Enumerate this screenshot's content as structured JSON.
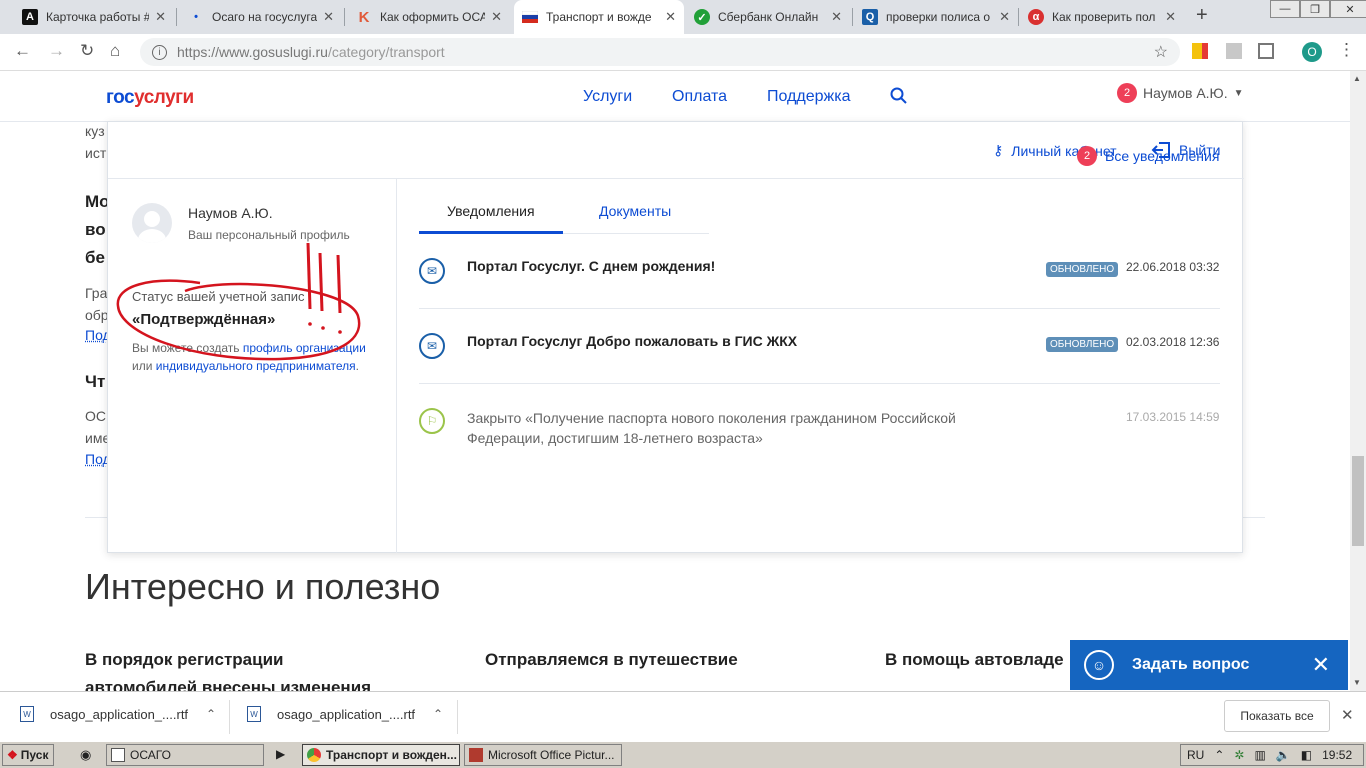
{
  "browser": {
    "tabs": [
      {
        "title": "Карточка работы #",
        "icon": "A",
        "icon_bg": "#111",
        "icon_color": "#fff"
      },
      {
        "title": "Осаго на госуслуга",
        "icon": "•",
        "icon_bg": "transparent",
        "icon_color": "#0d4cd3"
      },
      {
        "title": "Как оформить ОСА",
        "icon": "K",
        "icon_bg": "transparent",
        "icon_color": "#e05a3a"
      },
      {
        "title": "Транспорт и вожде",
        "icon": "",
        "icon_bg": "transparent",
        "icon_color": "#000"
      },
      {
        "title": "Сбербанк Онлайн",
        "icon": "✓",
        "icon_bg": "#21a038",
        "icon_color": "#fff"
      },
      {
        "title": "проверки полиса о",
        "icon": "Q",
        "icon_bg": "#1a5fa8",
        "icon_color": "#fff"
      },
      {
        "title": "Как проверить пол",
        "icon": "α",
        "icon_bg": "#d93030",
        "icon_color": "#fff"
      }
    ],
    "url": "https://www.gosuslugi.ru/category/transport",
    "url_host": "https://www.gosuslugi.ru",
    "url_path": "/category/transport",
    "profile_letter": "O"
  },
  "header": {
    "logo_part1": "гос",
    "logo_part2": "услуги",
    "nav": [
      "Услуги",
      "Оплата",
      "Поддержка"
    ],
    "notif_count": "2",
    "user_name": "Наумов А.Ю."
  },
  "background": {
    "frag1": "куз",
    "frag2": "ист",
    "bold1": "Мо",
    "bold2": "во",
    "bold3": "бе",
    "frag3": "Гра",
    "frag4": "обр",
    "link1": "Под",
    "bold4": "Чт",
    "frag5": "ОС",
    "frag6": "име",
    "link2": "Под",
    "section_title": "Интересно и полезно",
    "col1": [
      "В порядок регистрации",
      "автомобилей внесены изменения"
    ],
    "col2": "Отправляемся в путешествие",
    "col3": "В помощь автовладе"
  },
  "panel": {
    "cabinet_label": "Личный кабинет",
    "logout_label": "Выйти",
    "profile_name": "Наумов А.Ю.",
    "profile_sub": "Ваш персональный профиль",
    "status_label": "Статус вашей учетной запис",
    "status_value": "«Подтверждённая»",
    "note_pre": "Вы можете создать ",
    "note_link1": "профиль организации",
    "note_mid": " или ",
    "note_link2": "индивидуального предпринимателя",
    "note_post": ".",
    "tab_notifications": "Уведомления",
    "tab_documents": "Документы",
    "all_notif_count": "2",
    "all_notif_label": "Все уведомления",
    "notifications": [
      {
        "title": "Портал Госуслуг. С днем рождения!",
        "badge": "ОБНОВЛЕНО",
        "date": "22.06.2018 03:32"
      },
      {
        "title": "Портал Госуслуг Добро пожаловать в ГИС ЖКХ",
        "badge": "ОБНОВЛЕНО",
        "date": "02.03.2018 12:36"
      },
      {
        "text": "Закрыто «Получение паспорта нового поколения гражданином Российской Федерации, достигшим 18-летнего возраста»",
        "date": "17.03.2015 14:59"
      }
    ]
  },
  "chat": {
    "label": "Задать вопрос"
  },
  "downloads": {
    "files": [
      "osago_application_....rtf",
      "osago_application_....rtf"
    ],
    "show_all": "Показать все"
  },
  "taskbar": {
    "start": "Пуск",
    "tasks": [
      "ОСАГО",
      "Транспорт и вожден...",
      "Microsoft Office Pictur..."
    ],
    "lang": "RU",
    "time": "19:52"
  },
  "colors": {
    "accent": "#0d4cd3",
    "logo_red": "#e02e2e",
    "badge_red": "#ee3f58",
    "marker": "#d4141e"
  }
}
